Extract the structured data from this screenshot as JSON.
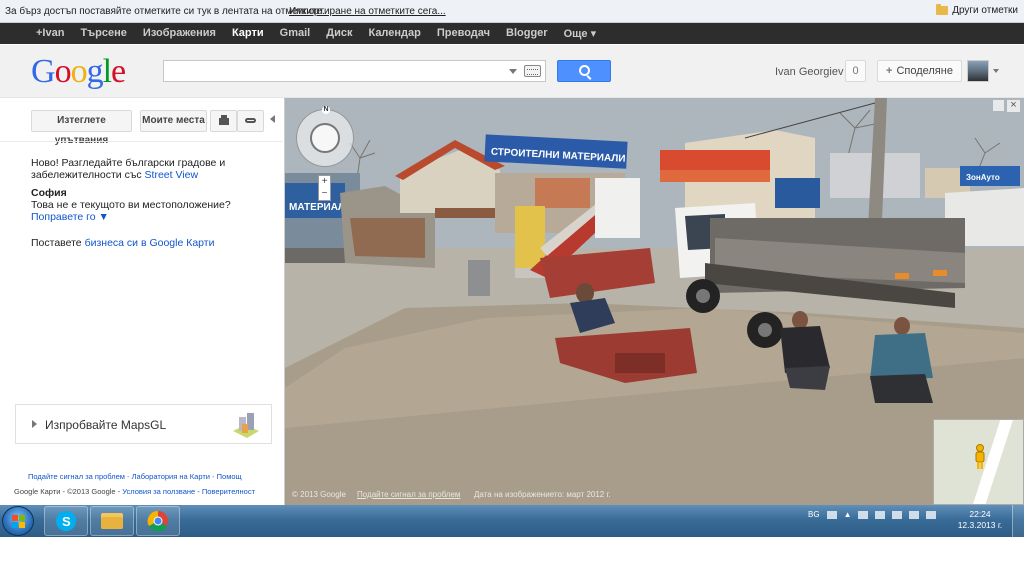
{
  "bookmarks_bar": {
    "message": "За бърз достъп поставяйте отметките си тук в лентата на отметките.",
    "import_link": "Импортиране на отметките сега...",
    "other_bookmarks": "Други отметки"
  },
  "google_bar": {
    "items": [
      {
        "label": "+Ivan"
      },
      {
        "label": "Търсене"
      },
      {
        "label": "Изображения"
      },
      {
        "label": "Карти"
      },
      {
        "label": "Gmail"
      },
      {
        "label": "Диск"
      },
      {
        "label": "Календар"
      },
      {
        "label": "Преводач"
      },
      {
        "label": "Blogger"
      },
      {
        "label": "Още ▾"
      }
    ],
    "active_index": 3
  },
  "header": {
    "logo_letters": [
      "G",
      "o",
      "o",
      "g",
      "l",
      "e"
    ],
    "search_value": "",
    "user_name": "Ivan Georgiev",
    "notification_count": "0",
    "share_label": "Споделяне"
  },
  "left_panel": {
    "directions_button": "Изтеглете упътвания",
    "my_places_button": "Моите места",
    "new_line1": "Ново! Разгледайте български градове и",
    "new_line2_prefix": "забележителности със ",
    "street_view_link": "Street View",
    "city": "София",
    "not_location": "Това не е текущото ви местоположение?",
    "fix_link": "Поправете го ▼",
    "biz_prefix": "Поставете ",
    "biz_link": "бизнеса си в Google Карти",
    "mapsgl_label": "Изпробвайте MapsGL",
    "footer_links": [
      "Подайте сигнал за проблем",
      "Лаборатория на Карти",
      "Помощ"
    ],
    "footer_copyright": "Google Карти - ©2013 Google",
    "footer_terms": "Условия за ползване",
    "footer_privacy": "Поверителност"
  },
  "street_view": {
    "compass_label": "N",
    "zoom_in": "+",
    "zoom_out": "−",
    "close": "×",
    "copyright": "© 2013 Google",
    "report": "Подайте сигнал за проблем",
    "image_date": "Дата на изображението: март 2012 г.",
    "sign_main": "СТРОИТЕЛНИ МАТЕРИАЛИ",
    "sign_right": "ЗонАуто",
    "sign_left": "МАТЕРИАЛИ"
  },
  "taskbar": {
    "apps": [
      "skype",
      "windows-explorer",
      "chrome"
    ],
    "language": "BG",
    "time": "22:24",
    "date": "12.3.2013 г."
  },
  "colors": {
    "gbar_background": "#2d2d2d",
    "search_button": "#4d90fe",
    "link": "#1155cc",
    "taskbar": "#3a6c98"
  }
}
